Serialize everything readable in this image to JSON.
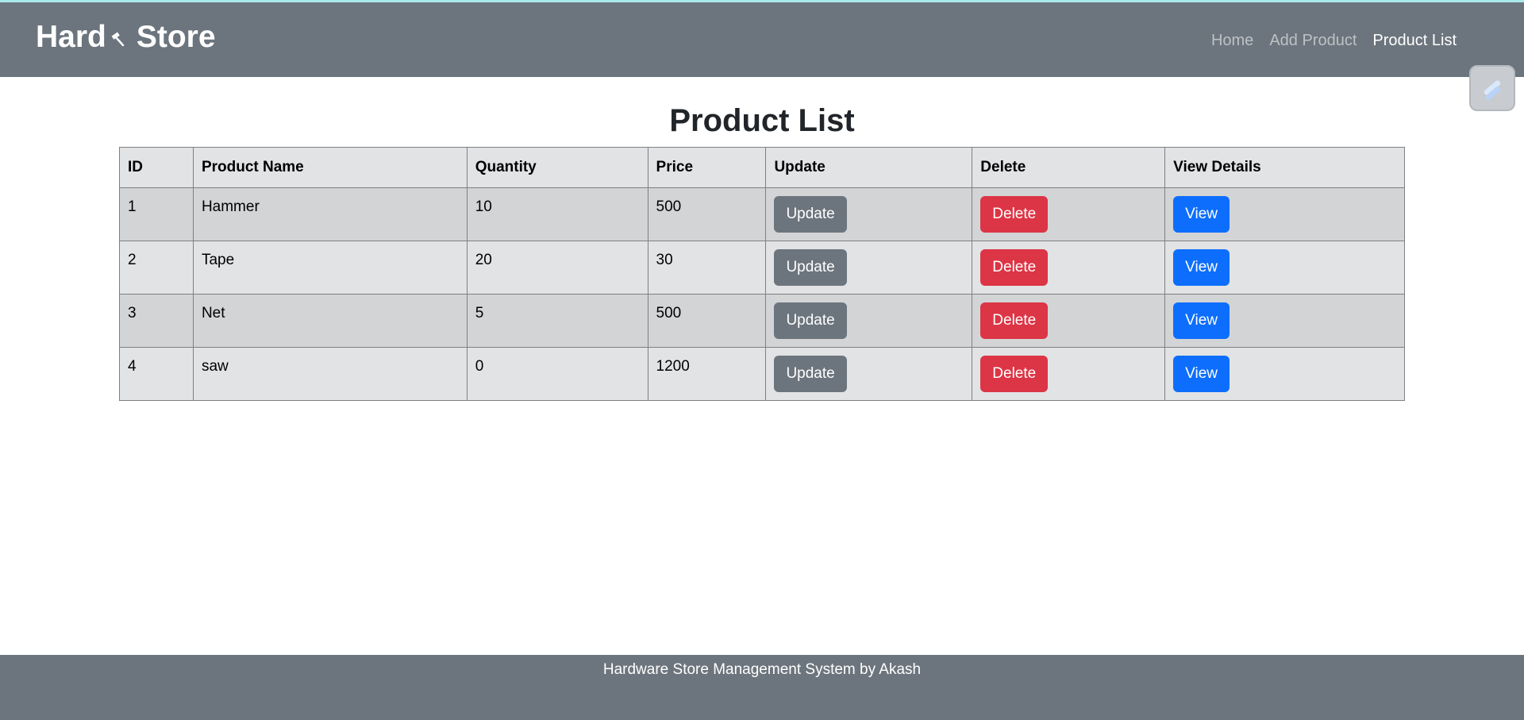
{
  "brand": {
    "name_left": "Hard",
    "name_right": "Store",
    "icon": "hammer-icon"
  },
  "nav": {
    "items": [
      {
        "label": "Home",
        "active": false
      },
      {
        "label": "Add Product",
        "active": false
      },
      {
        "label": "Product List",
        "active": true
      }
    ]
  },
  "floating_widget": {
    "icon": "pen-icon"
  },
  "main": {
    "title": "Product List"
  },
  "table": {
    "headers": [
      "ID",
      "Product Name",
      "Quantity",
      "Price",
      "Update",
      "Delete",
      "View Details"
    ],
    "rows": [
      {
        "id": "1",
        "name": "Hammer",
        "quantity": "10",
        "price": "500",
        "update_label": "Update",
        "delete_label": "Delete",
        "view_label": "View"
      },
      {
        "id": "2",
        "name": "Tape",
        "quantity": "20",
        "price": "30",
        "update_label": "Update",
        "delete_label": "Delete",
        "view_label": "View"
      },
      {
        "id": "3",
        "name": "Net",
        "quantity": "5",
        "price": "500",
        "update_label": "Update",
        "delete_label": "Delete",
        "view_label": "View"
      },
      {
        "id": "4",
        "name": "saw",
        "quantity": "0",
        "price": "1200",
        "update_label": "Update",
        "delete_label": "Delete",
        "view_label": "View"
      }
    ]
  },
  "footer": {
    "text": "Hardware Store Management System by Akash"
  },
  "colors": {
    "navbar": "#6c757d",
    "update_button": "#6c757d",
    "delete_button": "#dc3545",
    "view_button": "#0d6efd",
    "top_accent": "#a9e8ea"
  }
}
